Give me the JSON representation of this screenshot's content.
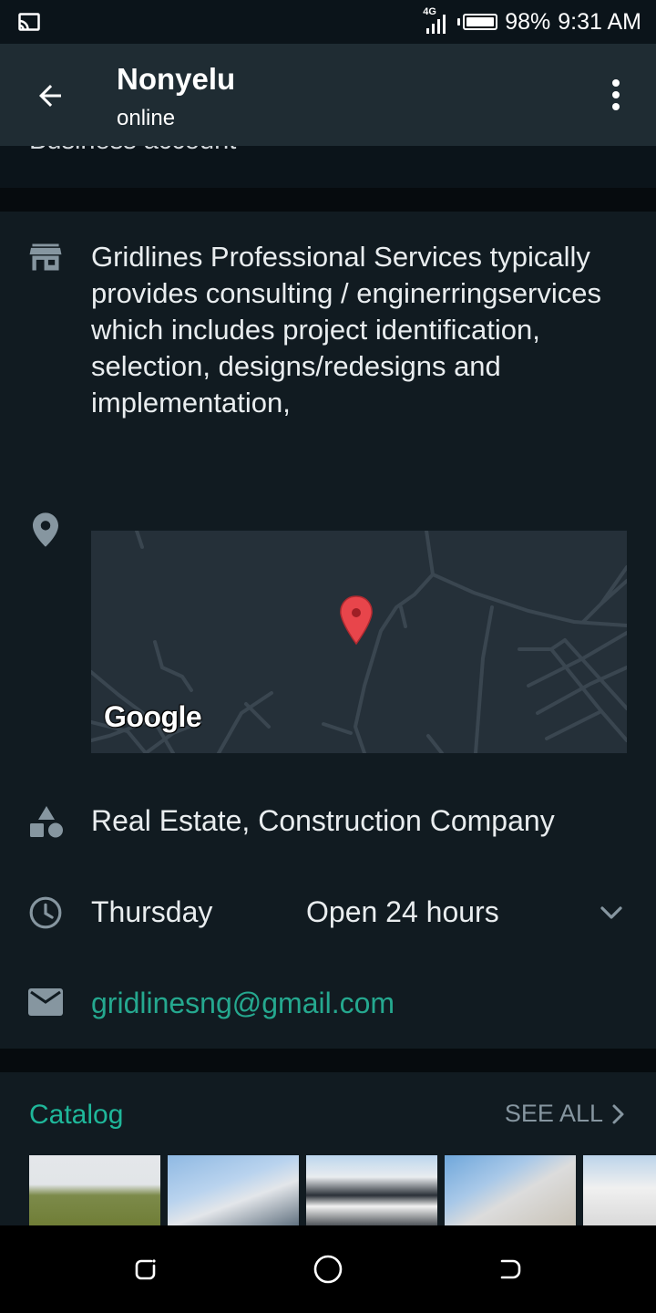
{
  "status_bar": {
    "network": "4G",
    "battery": "98%",
    "battery_level": 0.98,
    "time": "9:31 AM"
  },
  "header": {
    "title": "Nonyelu",
    "subtitle": "online"
  },
  "scrolled_label": "Business account",
  "business": {
    "description": "Gridlines Professional Services typically provides consulting / enginerringservices which includes project identification, selection, designs/redesigns and implementation,",
    "map_brand": "Google",
    "category": "Real Estate, Construction Company",
    "hours_day": "Thursday",
    "hours_value": "Open 24 hours",
    "email": "gridlinesng@gmail.com"
  },
  "catalog": {
    "title": "Catalog",
    "see_all": "SEE ALL"
  },
  "colors": {
    "header_bg": "#1f2c33",
    "card_bg": "#111b21",
    "accent": "#1fb79a",
    "map_pin": "#e8454b"
  },
  "icons": [
    "cast-icon",
    "signal-icon",
    "battery-icon",
    "back-arrow-icon",
    "more-vert-icon",
    "store-icon",
    "location-pin-icon",
    "map-marker-icon",
    "category-shapes-icon",
    "clock-icon",
    "chevron-down-icon",
    "mail-icon",
    "chevron-right-icon",
    "recents-icon",
    "home-icon",
    "back-nav-icon"
  ]
}
